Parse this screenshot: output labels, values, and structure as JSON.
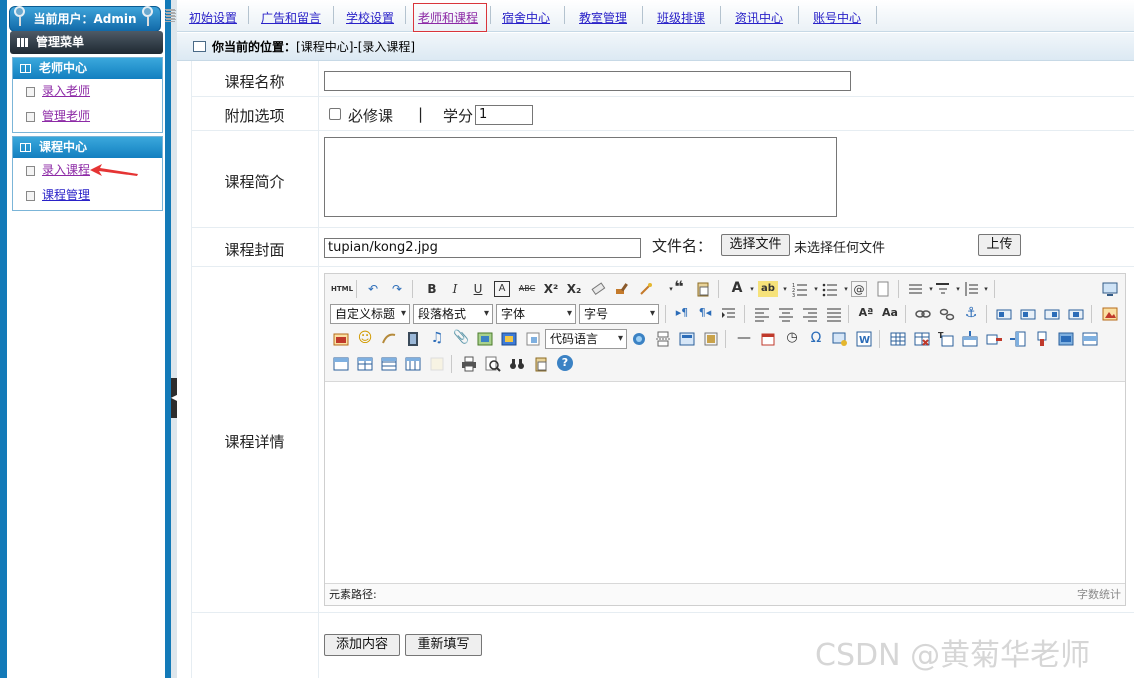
{
  "sidebar": {
    "user_label": "当前用户：Admin",
    "menu_title": "管理菜单",
    "groups": [
      {
        "title": "老师中心",
        "items": [
          {
            "label": "录入老师"
          },
          {
            "label": "管理老师"
          }
        ]
      },
      {
        "title": "课程中心",
        "items": [
          {
            "label": "录入课程"
          },
          {
            "label": "课程管理"
          }
        ]
      }
    ]
  },
  "nav": {
    "items": [
      {
        "label": "初始设置"
      },
      {
        "label": "广告和留言"
      },
      {
        "label": "学校设置"
      },
      {
        "label": "老师和课程"
      },
      {
        "label": "宿舍中心"
      },
      {
        "label": "教室管理"
      },
      {
        "label": "班级排课"
      },
      {
        "label": "资讯中心"
      },
      {
        "label": "账号中心"
      }
    ],
    "active_index": 3
  },
  "location": {
    "prefix": "你当前的位置：",
    "path": "[课程中心]-[录入课程]"
  },
  "form": {
    "course_name_label": "课程名称",
    "course_name_value": "",
    "options_label": "附加选项",
    "required_label": "必修课",
    "separator": "|",
    "credit_label": "学分",
    "credit_value": "1",
    "intro_label": "课程简介",
    "cover_label": "课程封面",
    "cover_value": "tupian/kong2.jpg",
    "filename_label": "文件名：",
    "choose_file_button": "选择文件",
    "no_file_text": "未选择任何文件",
    "upload_button": "上传",
    "detail_label": "课程详情",
    "submit_button": "添加内容",
    "reset_button": "重新填写"
  },
  "editor": {
    "html_label": "HTML",
    "selects": {
      "custom_title": "自定义标题",
      "paragraph": "段落格式",
      "font": "字体",
      "size": "字号",
      "code_lang": "代码语言"
    },
    "status_path": "元素路径:",
    "word_count": "字数统计"
  },
  "watermark": "CSDN @黄菊华老师",
  "colors": {
    "sidebar_blue": "#137ab8",
    "link": "#2a22c8",
    "visited_link": "#8d2aa6",
    "active_border": "#d9353b"
  }
}
